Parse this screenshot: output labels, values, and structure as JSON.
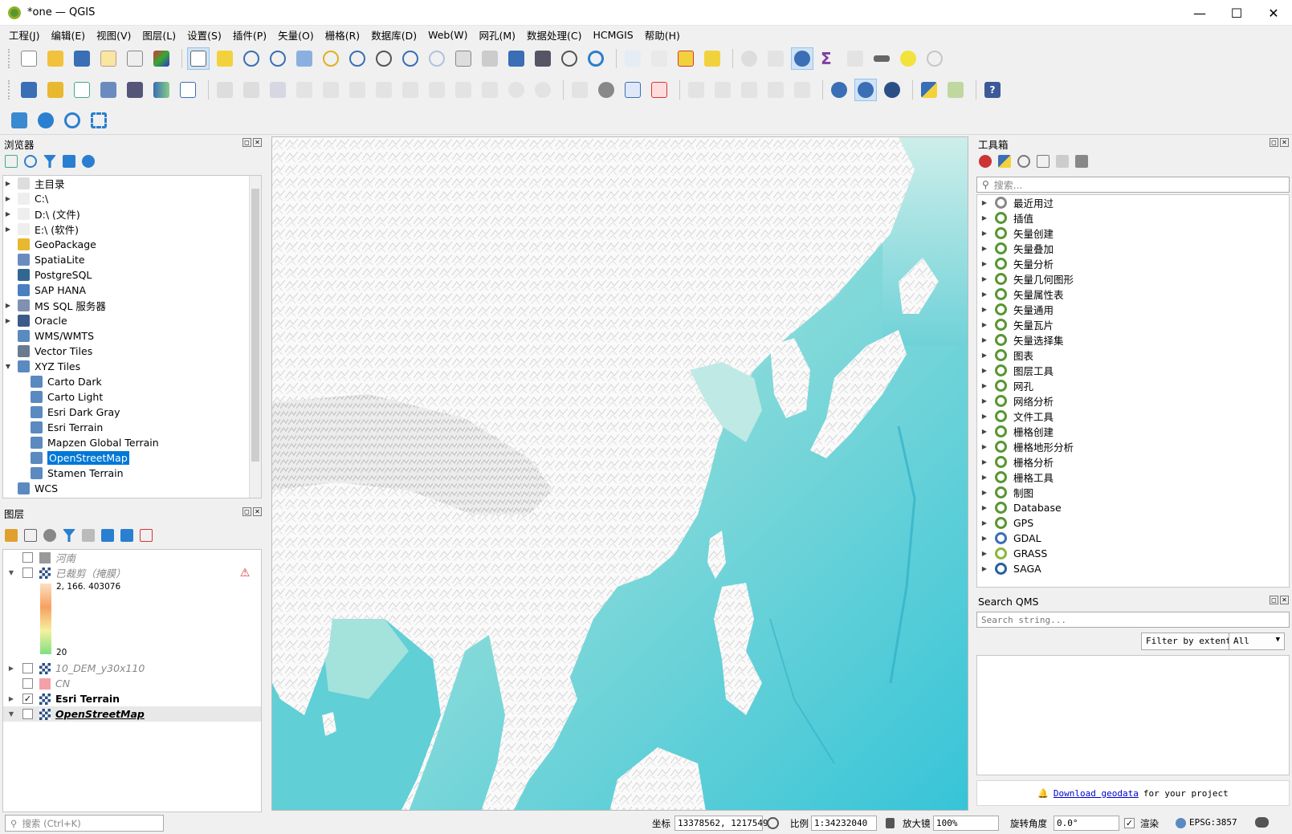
{
  "window": {
    "title": "*one — QGIS",
    "minimize": "—",
    "maximize": "☐",
    "close": "✕"
  },
  "menu": [
    "工程(J)",
    "编辑(E)",
    "视图(V)",
    "图层(L)",
    "设置(S)",
    "插件(P)",
    "矢量(O)",
    "栅格(R)",
    "数据库(D)",
    "Web(W)",
    "网孔(M)",
    "数据处理(C)",
    "HCMGIS",
    "帮助(H)"
  ],
  "browser": {
    "title": "浏览器",
    "items": [
      {
        "label": "主目录",
        "arrow": "▶",
        "indent": 0,
        "icon": "home-icon",
        "color": "#ddd"
      },
      {
        "label": "C:\\",
        "arrow": "▶",
        "indent": 0,
        "icon": "folder-icon",
        "color": "#eee"
      },
      {
        "label": "D:\\ (文件)",
        "arrow": "▶",
        "indent": 0,
        "icon": "folder-icon",
        "color": "#eee"
      },
      {
        "label": "E:\\ (软件)",
        "arrow": "▶",
        "indent": 0,
        "icon": "folder-icon",
        "color": "#eee"
      },
      {
        "label": "GeoPackage",
        "arrow": "",
        "indent": 0,
        "icon": "geopackage-icon",
        "color": "#e8b830"
      },
      {
        "label": "SpatiaLite",
        "arrow": "",
        "indent": 0,
        "icon": "feather-icon",
        "color": "#6a8bbf"
      },
      {
        "label": "PostgreSQL",
        "arrow": "",
        "indent": 0,
        "icon": "elephant-icon",
        "color": "#336791"
      },
      {
        "label": "SAP HANA",
        "arrow": "",
        "indent": 0,
        "icon": "grid-icon",
        "color": "#4a7fc0"
      },
      {
        "label": "MS SQL 服务器",
        "arrow": "▶",
        "indent": 0,
        "icon": "mssql-icon",
        "color": "#8090b0"
      },
      {
        "label": "Oracle",
        "arrow": "▶",
        "indent": 0,
        "icon": "oracle-icon",
        "color": "#3b5a8a"
      },
      {
        "label": "WMS/WMTS",
        "arrow": "",
        "indent": 0,
        "icon": "globe-icon",
        "color": "#5a8ac0"
      },
      {
        "label": "Vector Tiles",
        "arrow": "",
        "indent": 0,
        "icon": "tiles-icon",
        "color": "#6a7a90"
      },
      {
        "label": "XYZ Tiles",
        "arrow": "▼",
        "indent": 0,
        "icon": "xyz-icon",
        "color": "#5a8ac0"
      },
      {
        "label": "Carto Dark",
        "arrow": "",
        "indent": 1,
        "icon": "xyz-icon",
        "color": "#5a8ac0"
      },
      {
        "label": "Carto Light",
        "arrow": "",
        "indent": 1,
        "icon": "xyz-icon",
        "color": "#5a8ac0"
      },
      {
        "label": "Esri Dark Gray",
        "arrow": "",
        "indent": 1,
        "icon": "xyz-icon",
        "color": "#5a8ac0"
      },
      {
        "label": "Esri Terrain",
        "arrow": "",
        "indent": 1,
        "icon": "xyz-icon",
        "color": "#5a8ac0"
      },
      {
        "label": "Mapzen Global Terrain",
        "arrow": "",
        "indent": 1,
        "icon": "xyz-icon",
        "color": "#5a8ac0"
      },
      {
        "label": "OpenStreetMap",
        "arrow": "",
        "indent": 1,
        "icon": "xyz-icon",
        "color": "#5a8ac0",
        "selected": true
      },
      {
        "label": "Stamen Terrain",
        "arrow": "",
        "indent": 1,
        "icon": "xyz-icon",
        "color": "#5a8ac0"
      },
      {
        "label": "WCS",
        "arrow": "",
        "indent": 0,
        "icon": "globe-icon",
        "color": "#5a8ac0"
      }
    ]
  },
  "layers": {
    "title": "图层",
    "items": [
      {
        "label": "河南",
        "arrow": "",
        "checked": "",
        "swatch": "#999",
        "style": ""
      },
      {
        "label": "已裁剪（掩膜）",
        "arrow": "▼",
        "checked": "",
        "swatch": "raster",
        "style": "",
        "warn": true
      },
      {
        "label": "10_DEM_y30x110",
        "arrow": "▶",
        "checked": "",
        "swatch": "raster",
        "style": ""
      },
      {
        "label": "CN",
        "arrow": "",
        "checked": "",
        "swatch": "#f4a0a8",
        "style": ""
      },
      {
        "label": "Esri Terrain",
        "arrow": "▶",
        "checked": "✓",
        "swatch": "raster",
        "style": "bold"
      },
      {
        "label": "OpenStreetMap",
        "arrow": "▼",
        "checked": "",
        "swatch": "raster",
        "style": "bold-it"
      }
    ],
    "ramp_max": "2, 166. 403076",
    "ramp_min": "20"
  },
  "toolbox": {
    "title": "工具箱",
    "search_placeholder": "搜索...",
    "items": [
      "最近用过",
      "插值",
      "矢量创建",
      "矢量叠加",
      "矢量分析",
      "矢量几何图形",
      "矢量属性表",
      "矢量通用",
      "矢量瓦片",
      "矢量选择集",
      "图表",
      "图层工具",
      "网孔",
      "网络分析",
      "文件工具",
      "栅格创建",
      "栅格地形分析",
      "栅格分析",
      "栅格工具",
      "制图",
      "Database",
      "GPS",
      "GDAL",
      "GRASS",
      "SAGA"
    ]
  },
  "qms": {
    "title": "Search QMS",
    "search_placeholder": "Search string...",
    "filter_button": "Filter by extent",
    "filter_select": "All",
    "download_link": "Download geodata",
    "download_suffix": "for your project"
  },
  "status": {
    "search_placeholder": "搜索 (Ctrl+K)",
    "coord_label": "坐标",
    "coord_value": "13378562, 1217549",
    "scale_label": "比例",
    "scale_value": "1:34232040",
    "magnifier_label": "放大镜",
    "magnifier_value": "100%",
    "rotation_label": "旋转角度",
    "rotation_value": "0.0°",
    "render_label": "渲染",
    "crs": "EPSG:3857"
  },
  "colors": {
    "accent": "#0078d7",
    "qgis_green": "#589632",
    "ocean_light": "#c7ede8",
    "ocean_deep": "#33c4d6"
  }
}
